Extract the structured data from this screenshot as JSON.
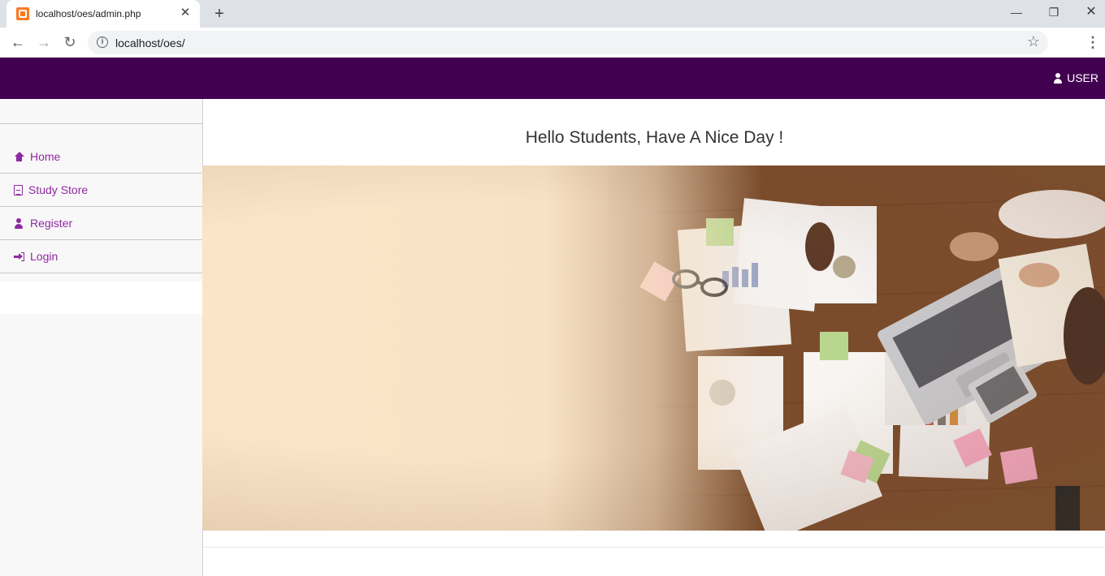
{
  "browser": {
    "tab_title": "localhost/oes/admin.php",
    "url": "localhost/oes/",
    "new_tab_symbol": "+",
    "window_controls": [
      "minimize",
      "restore",
      "close"
    ]
  },
  "topbar": {
    "user_label": "USER",
    "bg_color": "#420050"
  },
  "sidebar": {
    "items": [
      {
        "label": "Home",
        "icon": "home-icon"
      },
      {
        "label": "Study Store",
        "icon": "document-icon"
      },
      {
        "label": "Register",
        "icon": "user-icon"
      },
      {
        "label": "Login",
        "icon": "sign-in-icon"
      }
    ],
    "link_color": "#8e2aa0"
  },
  "main": {
    "greeting": "Hello Students, Have A Nice Day !"
  }
}
